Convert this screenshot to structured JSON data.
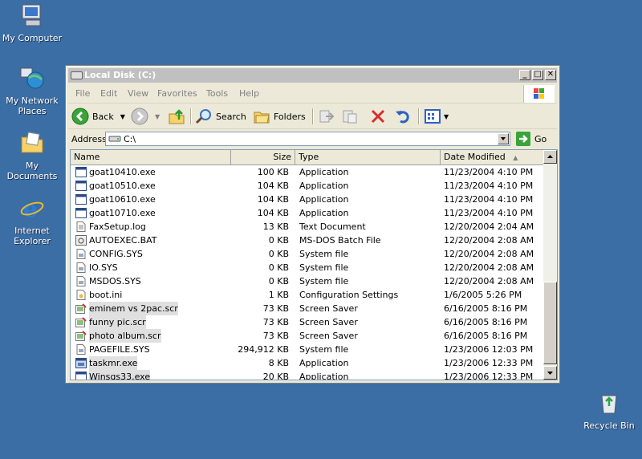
{
  "desktop": {
    "icons": [
      {
        "label": "My Computer"
      },
      {
        "label1": "My Network",
        "label2": "Places"
      },
      {
        "label": "My Documents"
      },
      {
        "label1": "Internet",
        "label2": "Explorer"
      },
      {
        "label": "Recycle Bin"
      }
    ]
  },
  "window": {
    "title": "Local Disk (C:)",
    "menu": [
      "File",
      "Edit",
      "View",
      "Favorites",
      "Tools",
      "Help"
    ],
    "toolbar": {
      "back": "Back",
      "search": "Search",
      "folders": "Folders"
    },
    "address": {
      "label": "Address",
      "value": "C:\\",
      "go": "Go"
    },
    "columns": [
      "Name",
      "Size",
      "Type",
      "Date Modified"
    ],
    "files": [
      {
        "name": "goat10410.exe",
        "size": "100 KB",
        "type": "Application",
        "date": "11/23/2004 4:10 PM",
        "icon": "exe"
      },
      {
        "name": "goat10510.exe",
        "size": "104 KB",
        "type": "Application",
        "date": "11/23/2004 4:10 PM",
        "icon": "exe"
      },
      {
        "name": "goat10610.exe",
        "size": "104 KB",
        "type": "Application",
        "date": "11/23/2004 4:10 PM",
        "icon": "exe"
      },
      {
        "name": "goat10710.exe",
        "size": "104 KB",
        "type": "Application",
        "date": "11/23/2004 4:10 PM",
        "icon": "exe"
      },
      {
        "name": "FaxSetup.log",
        "size": "13 KB",
        "type": "Text Document",
        "date": "12/20/2004 2:04 AM",
        "icon": "txt"
      },
      {
        "name": "AUTOEXEC.BAT",
        "size": "0 KB",
        "type": "MS-DOS Batch File",
        "date": "12/20/2004 2:08 AM",
        "icon": "bat"
      },
      {
        "name": "CONFIG.SYS",
        "size": "0 KB",
        "type": "System file",
        "date": "12/20/2004 2:08 AM",
        "icon": "sys"
      },
      {
        "name": "IO.SYS",
        "size": "0 KB",
        "type": "System file",
        "date": "12/20/2004 2:08 AM",
        "icon": "sys"
      },
      {
        "name": "MSDOS.SYS",
        "size": "0 KB",
        "type": "System file",
        "date": "12/20/2004 2:08 AM",
        "icon": "sys"
      },
      {
        "name": "boot.ini",
        "size": "1 KB",
        "type": "Configuration Settings",
        "date": "1/6/2005 5:26 PM",
        "icon": "ini"
      },
      {
        "name": "eminem vs 2pac.scr",
        "size": "73 KB",
        "type": "Screen Saver",
        "date": "6/16/2005 8:16 PM",
        "icon": "scr",
        "selected": true
      },
      {
        "name": "funny pic.scr",
        "size": "73 KB",
        "type": "Screen Saver",
        "date": "6/16/2005 8:16 PM",
        "icon": "scr",
        "selected": true
      },
      {
        "name": "photo album.scr",
        "size": "73 KB",
        "type": "Screen Saver",
        "date": "6/16/2005 8:16 PM",
        "icon": "scr",
        "selected": true
      },
      {
        "name": "PAGEFILE.SYS",
        "size": "294,912 KB",
        "type": "System file",
        "date": "1/23/2006 12:03 PM",
        "icon": "sys"
      },
      {
        "name": "taskmr.exe",
        "size": "8 KB",
        "type": "Application",
        "date": "1/23/2006 12:33 PM",
        "icon": "exe2",
        "selected": true
      },
      {
        "name": "Winsgs33.exe",
        "size": "20 KB",
        "type": "Application",
        "date": "1/23/2006 12:33 PM",
        "icon": "exe",
        "selected": true
      }
    ]
  },
  "colors": {
    "desktop": "#3a6ea5",
    "selection": "#e0e0e0"
  }
}
